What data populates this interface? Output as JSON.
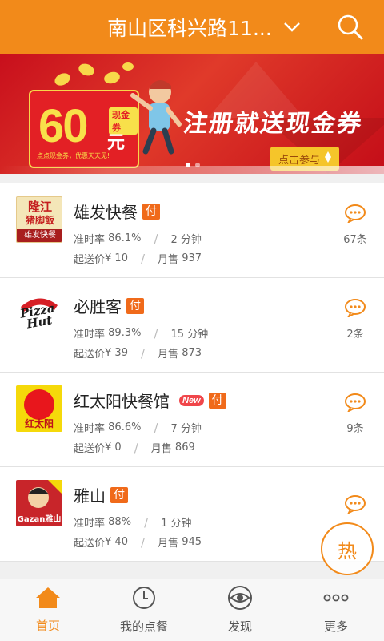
{
  "header": {
    "location": "南山区科兴路11...",
    "icons": {
      "dropdown": "chevron-down-icon",
      "search": "search-icon"
    }
  },
  "banner": {
    "voucher_amount": "60",
    "voucher_unit": "元",
    "voucher_tag": "现金券",
    "voucher_small_text": "点点现金券，优惠天天见!",
    "slogan": "注册就送现金券",
    "button_label": "点击参与",
    "dots_count": 2,
    "active_dot": 1
  },
  "restaurants": [
    {
      "name": "雄发快餐",
      "logo": "xiongfa-logo",
      "logo_text_top": "隆江\n猪脚饭",
      "logo_text_bottom": "雄发快餐",
      "is_new": false,
      "pay_badge": "付",
      "ontime_label": "准时率",
      "ontime_rate": "86.1%",
      "delivery_time": "2 分钟",
      "min_order_label": "起送价",
      "min_order": "¥ 10",
      "monthly_sales_label": "月售",
      "monthly_sales": "937",
      "review_count": "67条"
    },
    {
      "name": "必胜客",
      "logo": "pizza-hut-logo",
      "logo_text_top": "Pizza",
      "logo_text_bottom": "Hut",
      "is_new": false,
      "pay_badge": "付",
      "ontime_label": "准时率",
      "ontime_rate": "89.3%",
      "delivery_time": "15 分钟",
      "min_order_label": "起送价",
      "min_order": "¥ 39",
      "monthly_sales_label": "月售",
      "monthly_sales": "873",
      "review_count": "2条"
    },
    {
      "name": "红太阳快餐馆",
      "logo": "red-sun-logo",
      "logo_text_top": "",
      "logo_text_bottom": "红太阳",
      "is_new": true,
      "new_label": "New",
      "pay_badge": "付",
      "ontime_label": "准时率",
      "ontime_rate": "86.6%",
      "delivery_time": "7 分钟",
      "min_order_label": "起送价",
      "min_order": "¥ 0",
      "monthly_sales_label": "月售",
      "monthly_sales": "869",
      "review_count": "9条"
    },
    {
      "name": "雅山",
      "logo": "gazan-logo",
      "logo_text_top": "Gazan",
      "logo_text_bottom": "雅山",
      "is_new": false,
      "pay_badge": "付",
      "ontime_label": "准时率",
      "ontime_rate": "88%",
      "delivery_time": "1 分钟",
      "min_order_label": "起送价",
      "min_order": "¥ 40",
      "monthly_sales_label": "月售",
      "monthly_sales": "945",
      "review_count": ""
    }
  ],
  "hot_button": "热",
  "tabbar": [
    {
      "label": "首页",
      "icon": "home-icon",
      "active": true
    },
    {
      "label": "我的点餐",
      "icon": "clock-icon",
      "active": false
    },
    {
      "label": "发现",
      "icon": "eye-icon",
      "active": false
    },
    {
      "label": "更多",
      "icon": "more-dots-icon",
      "active": false
    }
  ],
  "colors": {
    "accent": "#f28a1a",
    "pay_badge": "#f06a1a",
    "new_badge": "#f0464a"
  }
}
